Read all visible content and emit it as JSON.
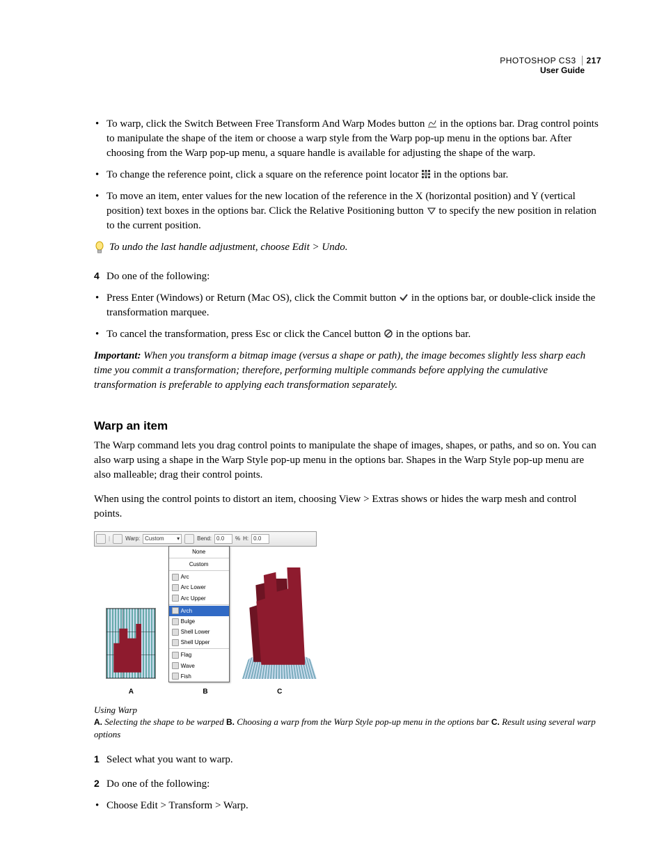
{
  "header": {
    "product": "PHOTOSHOP CS3",
    "pagenum": "217",
    "subtitle": "User Guide"
  },
  "bullets1": {
    "b1a": "To warp, click the Switch Between Free Transform And Warp Modes button ",
    "b1b": " in the options bar. Drag control points to manipulate the shape of the item or choose a warp style from the Warp pop-up menu in the options bar. After choosing from the Warp pop-up menu, a square handle is available for adjusting the shape of the warp.",
    "b2a": "To change the reference point, click a square on the reference point locator ",
    "b2b": " in the options bar.",
    "b3a": "To move an item, enter values for the new location of the reference in the X (horizontal position) and Y (vertical position) text boxes in the options bar. Click the Relative Positioning button ",
    "b3b": " to specify the new position in relation to the current position."
  },
  "tip": "To undo the last handle adjustment, choose Edit > Undo.",
  "step4": {
    "num": "4",
    "text": "Do one of the following:"
  },
  "bullets2": {
    "b1a": "Press Enter (Windows) or Return (Mac OS), click the Commit button ",
    "b1b": " in the options bar, or double-click inside the transformation marquee.",
    "b2a": "To cancel the transformation, press Esc or click the Cancel button ",
    "b2b": " in the options bar."
  },
  "important": {
    "label": "Important:",
    "text": " When you transform a bitmap image (versus a shape or path), the image becomes slightly less sharp each time you commit a transformation; therefore, performing multiple commands before applying the cumulative transformation is preferable to applying each transformation separately."
  },
  "section2": {
    "title": "Warp an item",
    "p1": "The Warp command lets you drag control points to manipulate the shape of images, shapes, or paths, and so on. You can also warp using a shape in the Warp Style pop-up menu in the options bar. Shapes in the Warp Style pop-up menu are also malleable; drag their control points.",
    "p2": "When using the control points to distort an item, choosing View > Extras shows or hides the warp mesh and control points."
  },
  "figure": {
    "toolbar": {
      "warp_label": "Warp:",
      "selected": "Custom",
      "bend_label": "Bend:",
      "bend_val": "0.0",
      "pct": "%",
      "h_label": "H:",
      "h_val": "0.0"
    },
    "dropdown": {
      "none": "None",
      "custom": "Custom",
      "arc": "Arc",
      "arclower": "Arc Lower",
      "arcupper": "Arc Upper",
      "arch": "Arch",
      "bulge": "Bulge",
      "shelllower": "Shell Lower",
      "shellupper": "Shell Upper",
      "flag": "Flag",
      "wave": "Wave",
      "fish": "Fish"
    },
    "labels": {
      "a": "A",
      "b": "B",
      "c": "C"
    },
    "caption_title": "Using Warp",
    "caption_a": "A.",
    "caption_a_text": " Selecting the shape to be warped  ",
    "caption_b": "B.",
    "caption_b_text": " Choosing a warp from the Warp Style pop-up menu in the options bar  ",
    "caption_c": "C.",
    "caption_c_text": " Result using several warp options"
  },
  "steps2": {
    "s1num": "1",
    "s1": "Select what you want to warp.",
    "s2num": "2",
    "s2": "Do one of the following:"
  },
  "bullets3": {
    "b1": "Choose Edit > Transform > Warp."
  }
}
